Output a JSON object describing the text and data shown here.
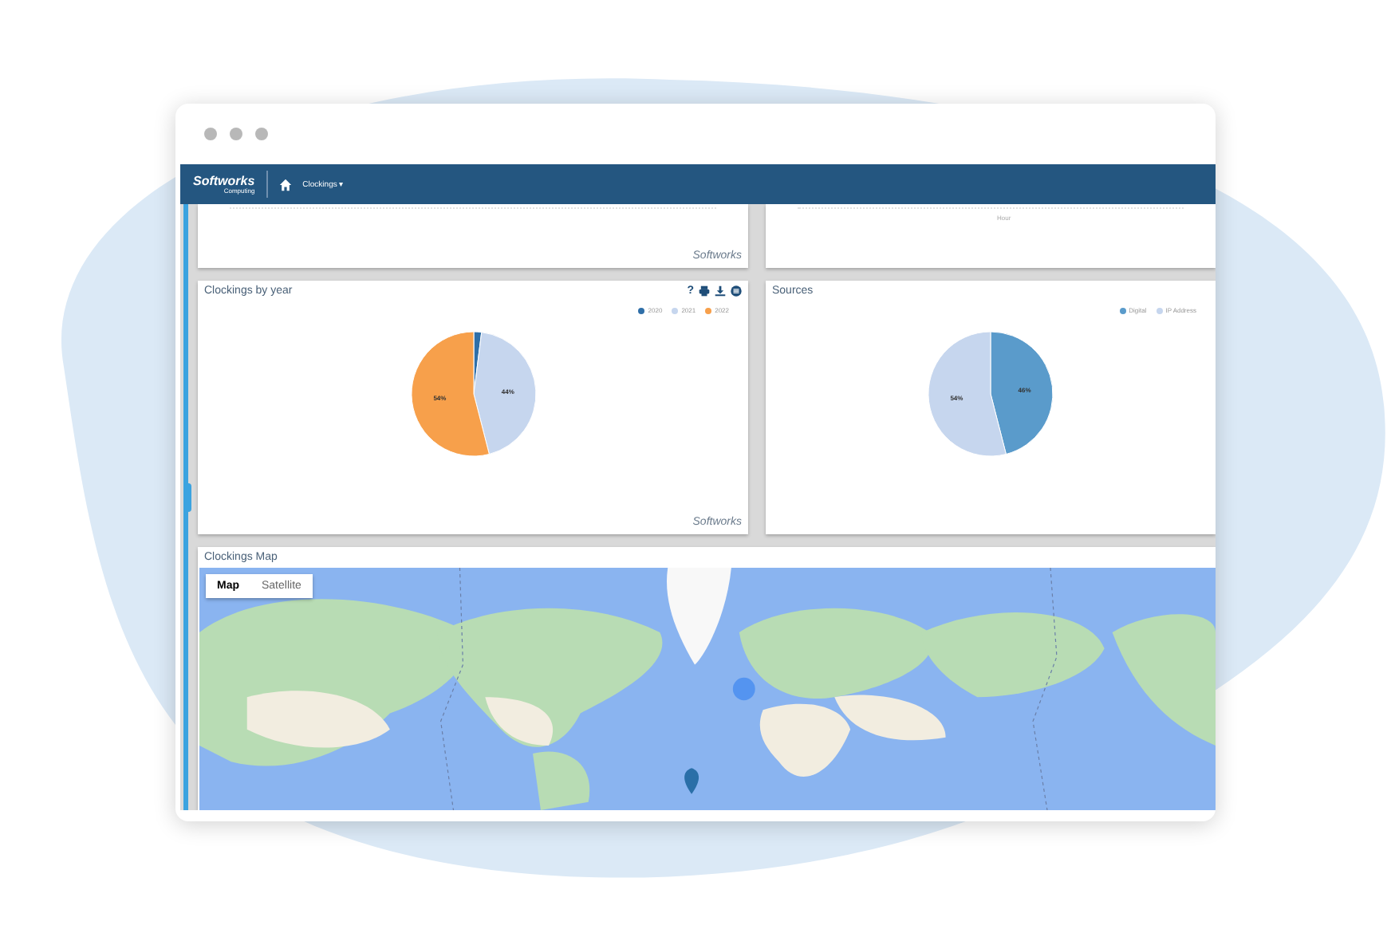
{
  "app": {
    "logo": "Softworks",
    "logo_sub": "Computing",
    "nav_menu": "Clockings ▾"
  },
  "top_cards": [
    {
      "credit": "Softworks"
    },
    {
      "axis_label": "Hour"
    }
  ],
  "charts": [
    {
      "title": "Clockings by year",
      "credit": "Softworks",
      "chart_data": {
        "type": "pie",
        "categories": [
          "2020",
          "2021",
          "2022"
        ],
        "series": [
          {
            "values": [
              2,
              44,
              54
            ]
          }
        ],
        "colors": [
          "#2f6fa8",
          "#c6d6ee",
          "#f7a04b"
        ],
        "value_labels": [
          null,
          "44%",
          "54%"
        ]
      },
      "tools": [
        {
          "kind": "help",
          "label": "?"
        },
        {
          "kind": "print"
        },
        {
          "kind": "download"
        },
        {
          "kind": "menu"
        }
      ]
    },
    {
      "title": "Sources",
      "chart_data": {
        "type": "pie",
        "categories": [
          "Digital",
          "IP Address"
        ],
        "series": [
          {
            "values": [
              46,
              54
            ]
          }
        ],
        "colors": [
          "#5a9bcb",
          "#c6d6ee"
        ],
        "value_labels": [
          "46%",
          "54%"
        ]
      }
    }
  ],
  "map": {
    "title": "Clockings Map",
    "kind": "picture",
    "map_types": [
      {
        "label": "Map",
        "selected": true
      },
      {
        "label": "Satellite",
        "selected": false
      }
    ]
  }
}
